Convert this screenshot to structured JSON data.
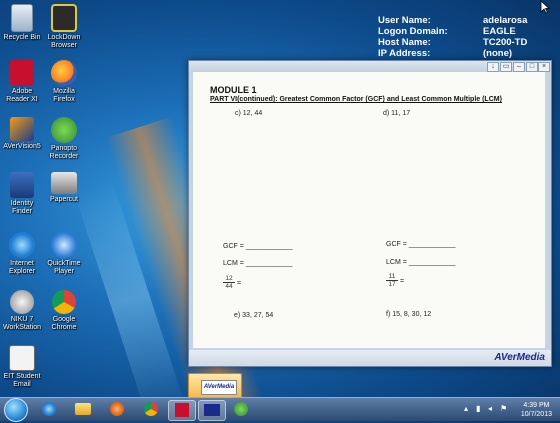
{
  "desktop_icons": [
    {
      "label": "Recycle Bin",
      "icon": "recycle-bin-icon"
    },
    {
      "label": "LockDown Browser",
      "icon": "lockdown-browser-icon"
    },
    {
      "label": "Adobe Reader XI",
      "icon": "adobe-reader-icon"
    },
    {
      "label": "Mozilla Firefox",
      "icon": "firefox-icon"
    },
    {
      "label": "AVerVision5",
      "icon": "avervision-icon"
    },
    {
      "label": "Panopto Recorder",
      "icon": "panopto-icon"
    },
    {
      "label": "Identity Finder",
      "icon": "identity-finder-icon"
    },
    {
      "label": "Papercut",
      "icon": "papercut-icon"
    },
    {
      "label": "Internet Explorer",
      "icon": "internet-explorer-icon"
    },
    {
      "label": "QuickTime Player",
      "icon": "quicktime-icon"
    },
    {
      "label": "NIKU 7 WorkStation",
      "icon": "niku-workstation-icon"
    },
    {
      "label": "Google Chrome",
      "icon": "chrome-icon"
    },
    {
      "label": "EIT Student Email",
      "icon": "student-email-icon"
    }
  ],
  "system_info": {
    "rows": [
      {
        "key": "User Name:",
        "value": "adelarosa"
      },
      {
        "key": "Logon Domain:",
        "value": "EAGLE"
      },
      {
        "key": "Host Name:",
        "value": "TC200-TD"
      },
      {
        "key": "IP Address:",
        "value": "(none)"
      }
    ]
  },
  "window": {
    "brand": "AVerMedia",
    "document": {
      "title": "MODULE 1",
      "subtitle": "PART VI(continued): Greatest Common Factor (GCF) and Least Common Multiple (LCM)",
      "problem_c": "c) 12, 44",
      "problem_d": "d) 11, 17",
      "gcf_left": "GCF = ____________",
      "lcm_left": "LCM = ____________",
      "gcf_right": "GCF = ____________",
      "lcm_right": "LCM = ____________",
      "frac_left_num": "12",
      "frac_left_den": "44",
      "frac_right_num": "11",
      "frac_right_den": "17",
      "frac_eq": "=",
      "problem_e": "e) 33, 27, 54",
      "problem_f": "f)   15, 8, 30, 12"
    }
  },
  "taskbar": {
    "time": "4:39 PM",
    "date": "10/7/2013",
    "thumbnail_label": "AVerMedia",
    "pinned": [
      "start-button",
      "ie-taskbar-icon",
      "explorer-taskbar-icon",
      "media-player-taskbar-icon",
      "chrome-taskbar-icon",
      "acrobat-taskbar-icon",
      "avermedia-taskbar-icon",
      "panopto-taskbar-icon"
    ]
  }
}
